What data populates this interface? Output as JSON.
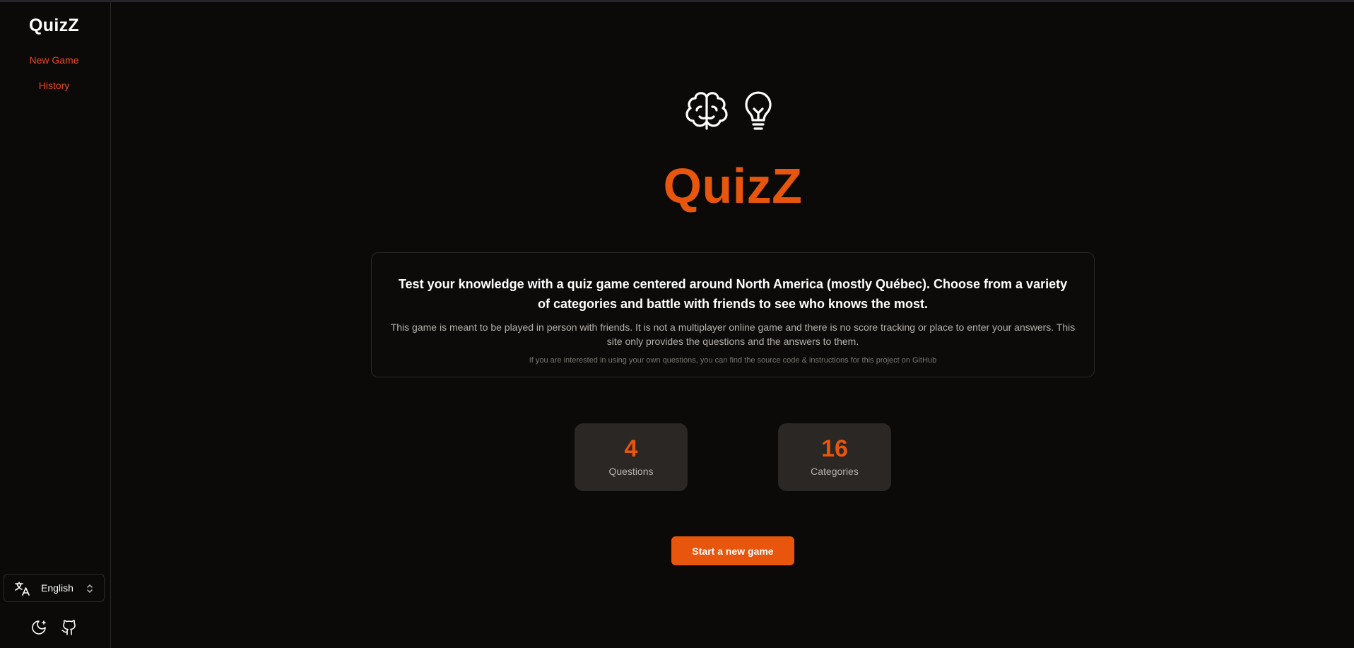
{
  "sidebar": {
    "brand": "QuizZ",
    "nav": [
      {
        "label": "New Game"
      },
      {
        "label": "History"
      }
    ],
    "language": {
      "label": "English",
      "icon": "translate-icon"
    },
    "footer_icons": [
      "moon-icon",
      "github-icon"
    ]
  },
  "hero": {
    "icons": [
      "brain-icon",
      "lightbulb-icon"
    ],
    "title": "QuizZ"
  },
  "info": {
    "lead": "Test your knowledge with a quiz game centered around North America (mostly Québec). Choose from a variety of categories and battle with friends to see who knows the most.",
    "body": "This game is meant to be played in person with friends. It is not a multiplayer online game and there is no score tracking or place to enter your answers. This site only provides the questions and the answers to them.",
    "small": "If you are interested in using your own questions, you can find the source code & instructions for this project on GitHub"
  },
  "stats": [
    {
      "value": "4",
      "label": "Questions"
    },
    {
      "value": "16",
      "label": "Categories"
    }
  ],
  "actions": {
    "start_label": "Start a new game"
  },
  "colors": {
    "accent": "#e8560d",
    "nav_link": "#f0451e",
    "background": "#0b0a09",
    "card": "#2a2725"
  }
}
